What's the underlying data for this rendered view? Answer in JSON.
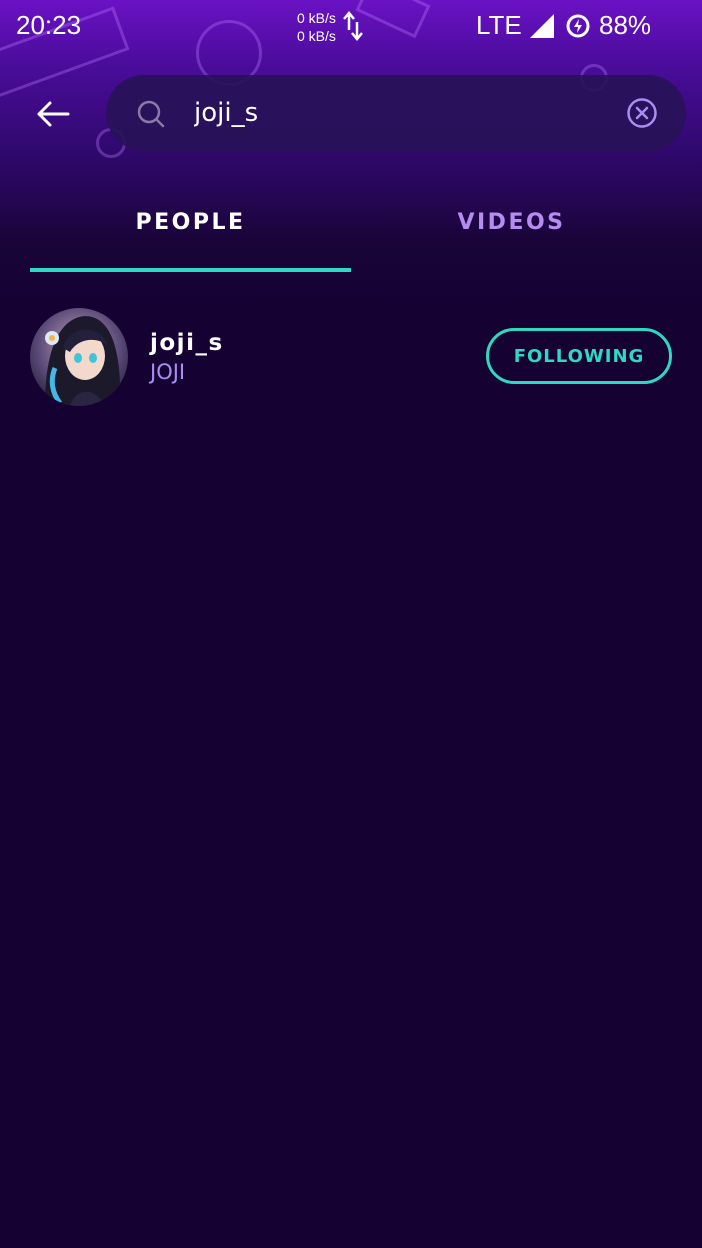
{
  "status_bar": {
    "time": "20:23",
    "net_up": "0 kB/s",
    "net_down": "0 kB/s",
    "network": "LTE",
    "battery": "88%"
  },
  "search": {
    "query": "joji_s",
    "back_icon": "arrow-left-icon",
    "search_icon": "search-icon",
    "clear_icon": "clear-circle-icon"
  },
  "tabs": [
    {
      "label": "PEOPLE",
      "active": true
    },
    {
      "label": "VIDEOS",
      "active": false
    }
  ],
  "results": [
    {
      "username": "joji_s",
      "display_name": "JOJI",
      "follow_label": "FOLLOWING"
    }
  ],
  "colors": {
    "accent": "#2fd8c2",
    "background": "#150233",
    "inactive_tab": "#b48cf2",
    "secondary_text": "#a98ef2"
  }
}
